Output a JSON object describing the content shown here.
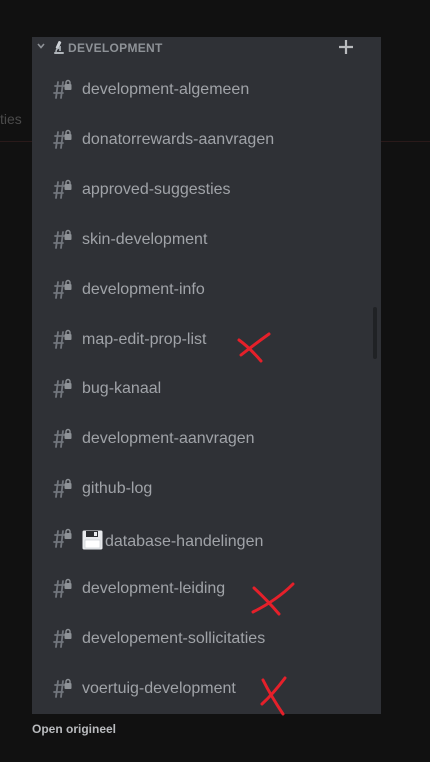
{
  "background": {
    "partial_text": "ties"
  },
  "category": {
    "name": "DEVELOPMENT",
    "collapse_icon": "chevron-down-icon",
    "emoji": "microscope-emoji",
    "add_icon": "plus-icon"
  },
  "channels": [
    {
      "name": "development-algemeen",
      "locked": true
    },
    {
      "name": "donatorrewards-aanvragen",
      "locked": true
    },
    {
      "name": "approved-suggesties",
      "locked": true
    },
    {
      "name": "skin-development",
      "locked": true
    },
    {
      "name": "development-info",
      "locked": true
    },
    {
      "name": "map-edit-prop-list",
      "locked": true,
      "marked_with_x": true
    },
    {
      "name": "bug-kanaal",
      "locked": true
    },
    {
      "name": "development-aanvragen",
      "locked": true
    },
    {
      "name": "github-log",
      "locked": true
    },
    {
      "name": "database-handelingen",
      "locked": true,
      "emoji": "floppy-disk-emoji"
    },
    {
      "name": "development-leiding",
      "locked": true,
      "marked_with_x": true
    },
    {
      "name": "developement-sollicitaties",
      "locked": true
    },
    {
      "name": "voertuig-development",
      "locked": true,
      "marked_with_x": true
    }
  ],
  "footer": {
    "link_label": "Open origineel"
  },
  "colors": {
    "panel_bg": "#2f3136",
    "channel_text": "#a0a3a8",
    "category_text": "#8e9297",
    "annotation_red": "#e5202a"
  }
}
